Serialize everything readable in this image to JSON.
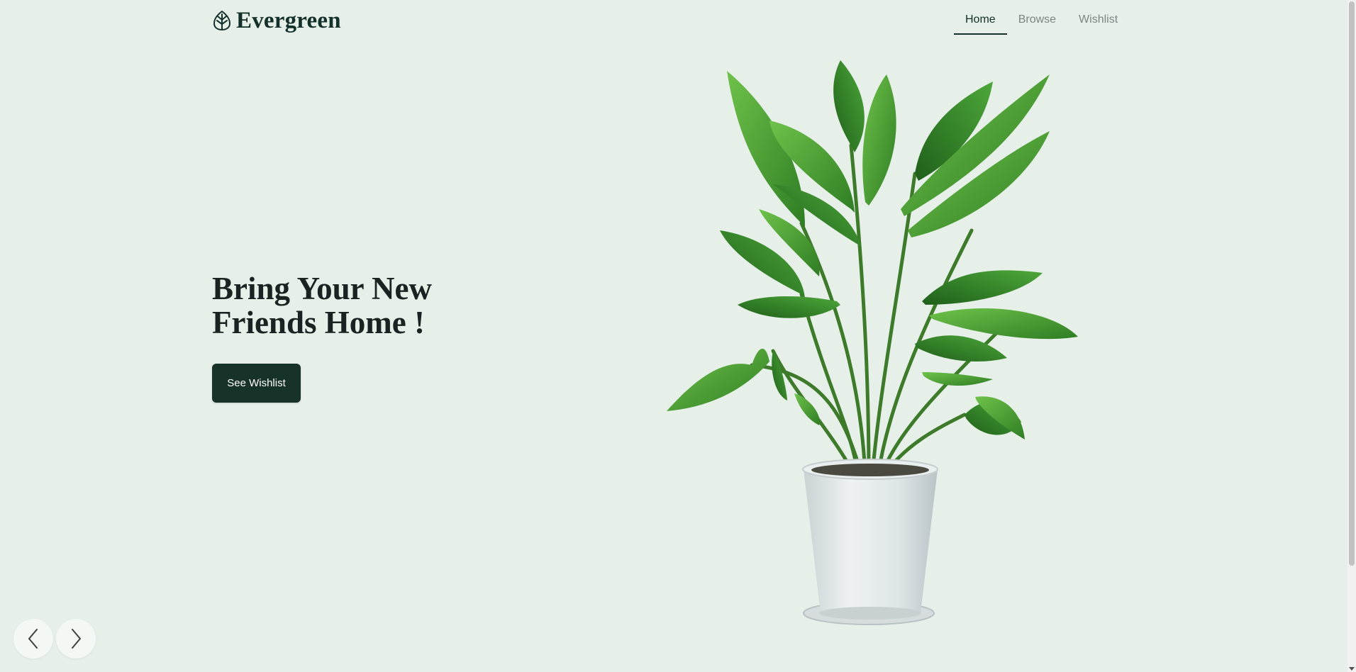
{
  "brand": {
    "name": "Evergreen",
    "logo_icon": "leaf-icon",
    "color": "#14302a"
  },
  "nav": {
    "items": [
      {
        "label": "Home",
        "active": true
      },
      {
        "label": "Browse",
        "active": false
      },
      {
        "label": "Wishlist",
        "active": false
      }
    ]
  },
  "hero": {
    "title_line1": "Bring Your New",
    "title_line2": "Friends Home !",
    "cta_label": "See Wishlist",
    "image": "potted-plant-image"
  },
  "carousel": {
    "prev_icon": "chevron-left-icon",
    "next_icon": "chevron-right-icon"
  },
  "colors": {
    "background": "#e6f0e9",
    "accent": "#173229",
    "nav_inactive": "#7c8582"
  }
}
